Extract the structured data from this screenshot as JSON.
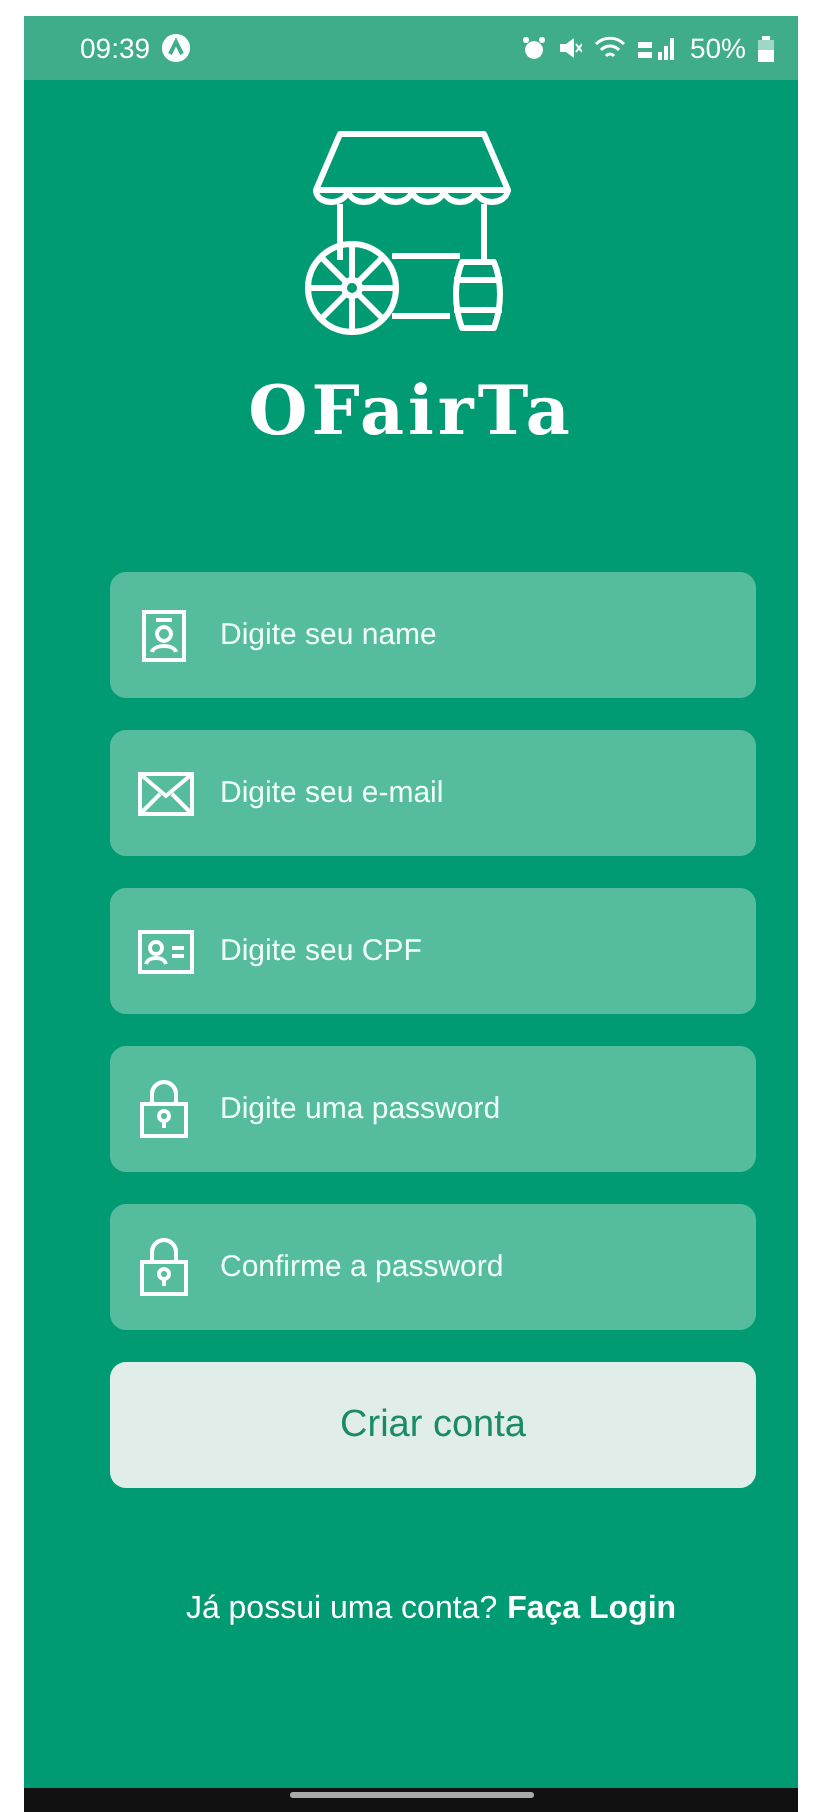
{
  "status_bar": {
    "time": "09:39",
    "battery": "50%"
  },
  "app": {
    "title": "OFairTa"
  },
  "fields": [
    {
      "kind": "badge",
      "placeholder": "Digite seu name"
    },
    {
      "kind": "email",
      "placeholder": "Digite seu e-mail"
    },
    {
      "kind": "card",
      "placeholder": "Digite seu CPF"
    },
    {
      "kind": "lock",
      "placeholder": "Digite uma password"
    },
    {
      "kind": "lock",
      "placeholder": "Confirme a password"
    }
  ],
  "submit": {
    "label": "Criar conta"
  },
  "footer": {
    "prompt": "Já possui uma conta?",
    "link": "Faça Login"
  }
}
